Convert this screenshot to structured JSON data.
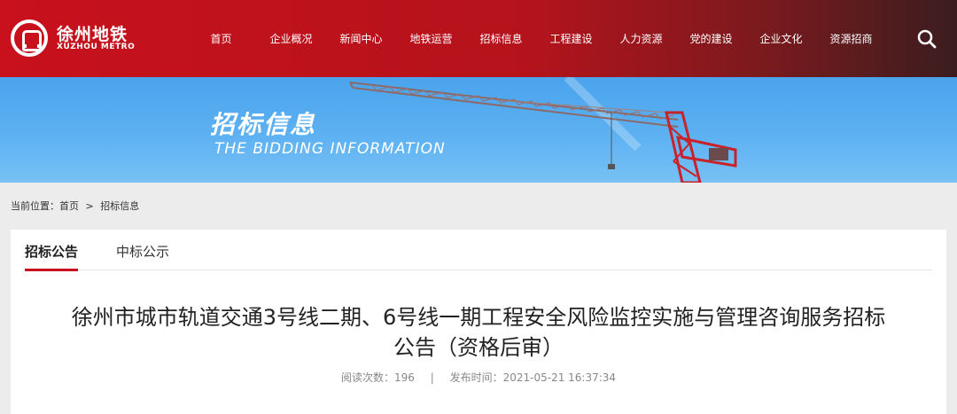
{
  "header": {
    "logo_cn": "徐州地铁",
    "logo_en": "XUZHOU METRO",
    "nav": [
      "首页",
      "企业概况",
      "新闻中心",
      "地铁运营",
      "招标信息",
      "工程建设",
      "人力资源",
      "党的建设",
      "企业文化",
      "资源招商"
    ],
    "search_icon": "search-icon"
  },
  "banner": {
    "title_cn": "招标信息",
    "title_en": "THE BIDDING INFORMATION"
  },
  "breadcrumb": {
    "prefix": "当前位置：",
    "home": "首页",
    "separator": ">",
    "current": "招标信息"
  },
  "tabs": [
    "招标公告",
    "中标公示"
  ],
  "article": {
    "title_line1": "徐州市城市轨道交通3号线二期、6号线一期工程安全风险监控实施与管理咨询服务招标",
    "title_line2": "公告（资格后审）",
    "views_label": "阅读次数：",
    "views": "196",
    "separator": "|",
    "published_label": "发布时间：",
    "published": "2021-05-21 16:37:34"
  },
  "colors": {
    "brand_red": "#c8111d",
    "banner_blue": "#5db1f2",
    "crane_red": "#c8232a"
  }
}
